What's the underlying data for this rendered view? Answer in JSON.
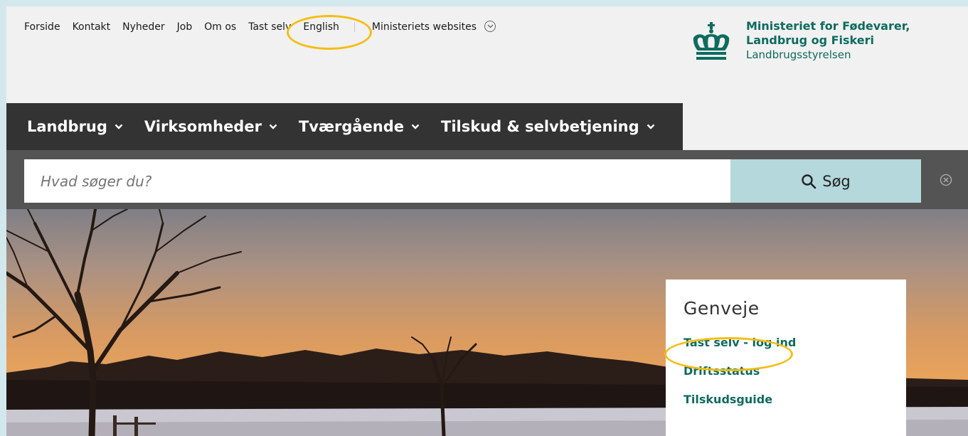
{
  "topnav": {
    "items": [
      "Forside",
      "Kontakt",
      "Nyheder",
      "Job",
      "Om os",
      "Tast selv",
      "English"
    ],
    "ministries": "Ministeriets websites",
    "ministries_icon": "chevron-down-circle-icon"
  },
  "logo": {
    "line1": "Ministeriet for Fødevarer,",
    "line2": "Landbrug og Fiskeri",
    "line3": "Landbrugsstyrelsen",
    "icon": "royal-crown-icon"
  },
  "mainnav": {
    "items": [
      "Landbrug",
      "Virksomheder",
      "Tværgående",
      "Tilskud & selvbetjening"
    ]
  },
  "search": {
    "placeholder": "Hvad søger du?",
    "button_label": "Søg",
    "button_icon": "search-icon",
    "clear_icon": "close-circle-icon"
  },
  "shortcuts": {
    "title": "Genveje",
    "links": [
      "Tast selv - log ind",
      "Driftsstatus",
      "Tilskudsguide"
    ]
  },
  "colors": {
    "brand_green": "#0e6b5f",
    "highlight": "#f5bd12",
    "nav_bg": "#333333",
    "search_band": "#545454",
    "search_button": "#b4d8dc"
  }
}
